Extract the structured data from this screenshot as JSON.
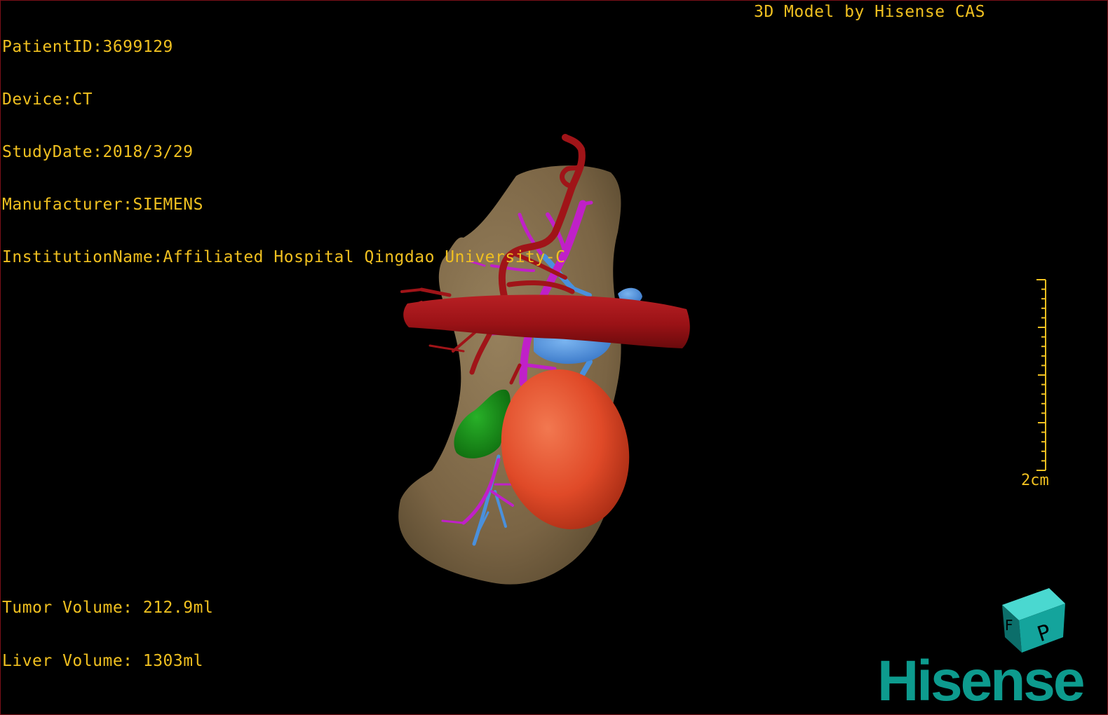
{
  "patient_info": {
    "patient_id": "PatientID:3699129",
    "device": "Device:CT",
    "study_date": "StudyDate:2018/3/29",
    "manufacturer": "Manufacturer:SIEMENS",
    "institution": "InstitutionName:Affiliated Hospital Qingdao University-C"
  },
  "model_credit": "3D Model by Hisense CAS",
  "volumes": {
    "tumor": "Tumor Volume: 212.9ml",
    "liver": "Liver Volume: 1303ml"
  },
  "scale_bar": {
    "label": "2cm"
  },
  "orientation_cube": {
    "face_front": "P",
    "face_left": "F"
  },
  "brand": "Hisense",
  "colors": {
    "overlay_text": "#f0c020",
    "liver": "#806848",
    "artery": "#a01418",
    "portal_vein": "#c020c8",
    "hepatic_vein": "#4a90dc",
    "tumor": "#e04a28",
    "gallbladder": "#1a8a1a",
    "brand": "#0d9b8e"
  }
}
